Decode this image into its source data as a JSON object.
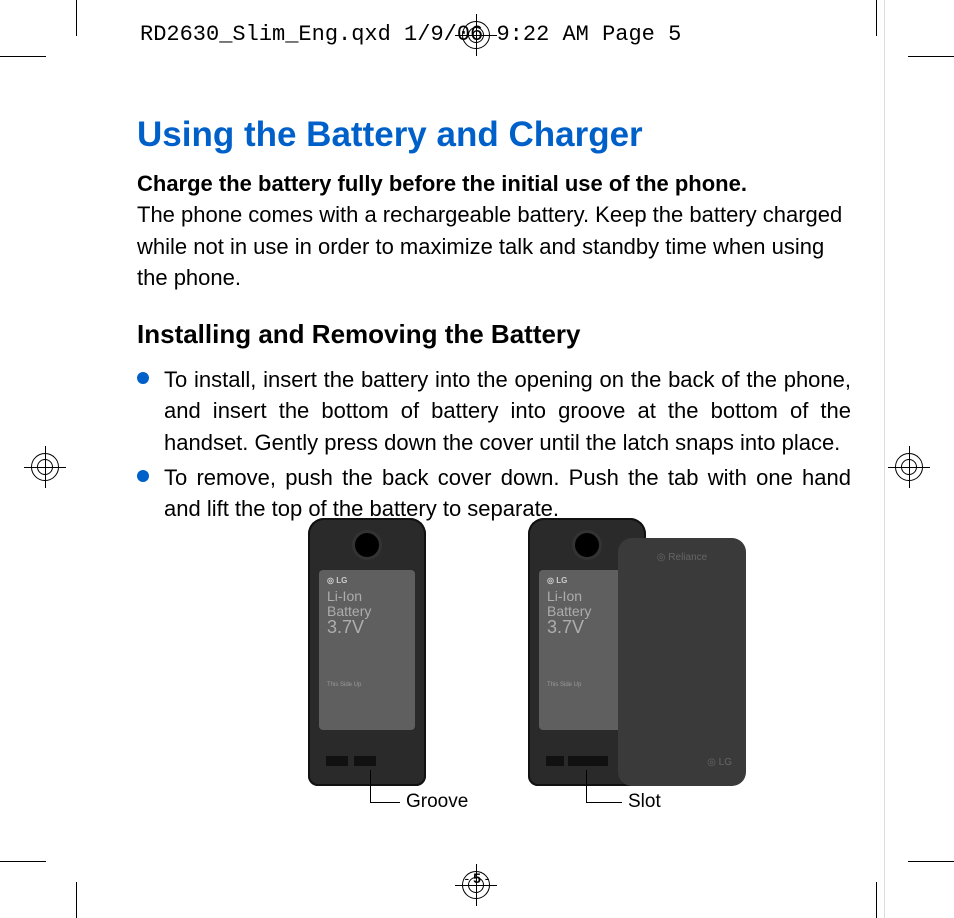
{
  "header_slug": "RD2630_Slim_Eng.qxd  1/9/06  9:22 AM  Page 5",
  "title": "Using the Battery and Charger",
  "lead_bold": "Charge the battery fully before the initial use of the phone.",
  "lead_rest": "The phone comes with a rechargeable battery. Keep the battery charged while not in use in order to maximize talk and standby time when using the phone.",
  "subhead": "Installing and Removing the Battery",
  "bullets": [
    "To install, insert the battery into the opening on the back of the phone, and insert the bottom of battery into groove at the bottom of the handset. Gently press down the cover until the latch snaps into place.",
    "To remove, push the back cover down. Push the tab with one hand and lift the top of the battery to separate."
  ],
  "figure": {
    "battery_brand": "LG",
    "battery_line1": "Li-Ion",
    "battery_line2": "Battery",
    "battery_voltage": "3.7V",
    "battery_side": "This Side Up",
    "cover_text1": "Reliance",
    "cover_text2": "LG",
    "callout_left": "Groove",
    "callout_right": "Slot"
  },
  "page_number": "5"
}
